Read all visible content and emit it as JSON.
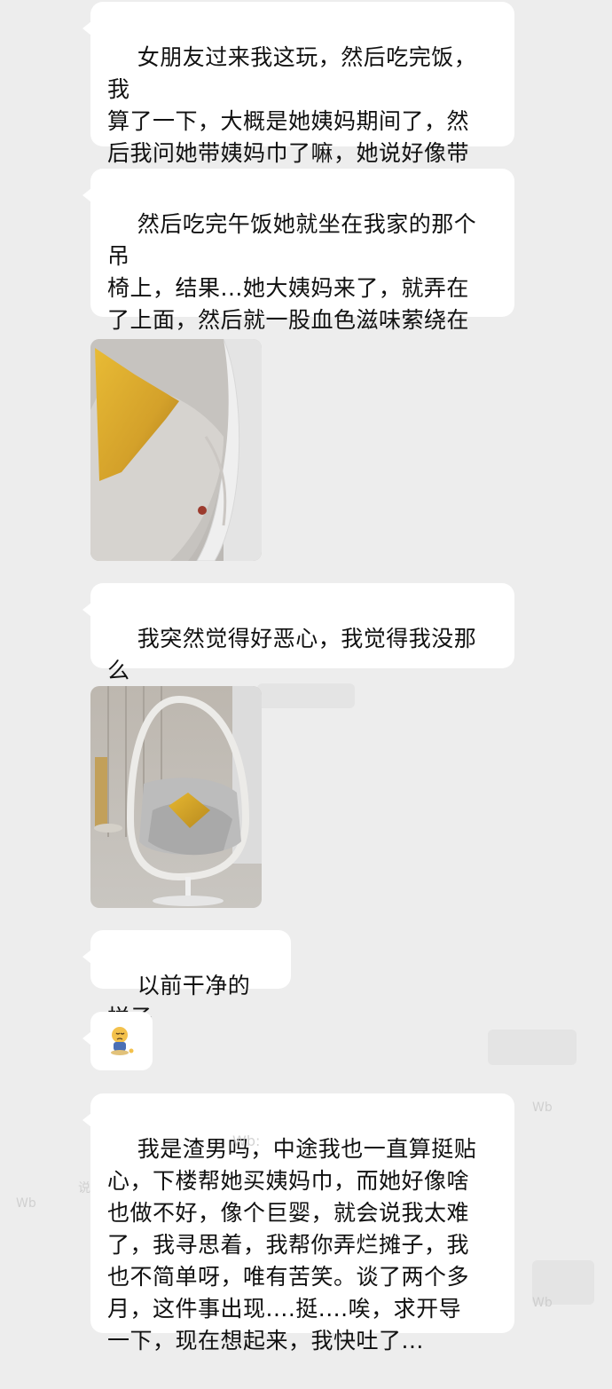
{
  "messages": [
    {
      "type": "text",
      "text": "女朋友过来我这玩，然后吃完饭，我\n算了一下，大概是她姨妈期间了，然\n后我问她带姨妈巾了嘛，她说好像带\n了，这是前提。"
    },
    {
      "type": "text",
      "text": "然后吃完午饭她就坐在我家的那个吊\n椅上，结果...她大姨妈来了，就弄在\n了上面，然后就一股血色滋味萦绕在\n鼻子。。。。"
    },
    {
      "type": "image",
      "icon": "stained-cushion-photo"
    },
    {
      "type": "text",
      "text": "我突然觉得好恶心，我觉得我没那么\n喜欢她了......"
    },
    {
      "type": "image",
      "icon": "hanging-chair-photo"
    },
    {
      "type": "text",
      "text": "以前干净的样子"
    },
    {
      "type": "emoji",
      "icon": "sad-sitting-emoji"
    },
    {
      "type": "text",
      "text": "我是渣男吗，中途我也一直算挺贴\n心，下楼帮她买姨妈巾，而她好像啥\n也做不好，像个巨婴，就会说我太难\n了，我寻思着，我帮你弄烂摊子，我\n也不简单呀，唯有苦笑。谈了两个多\n月，这件事出现....挺....唉，求开导\n一下，现在想起来，我快吐了..."
    }
  ],
  "watermarks": [
    "Wb:",
    "Wb",
    "Wb",
    "Wb",
    "说"
  ],
  "colors": {
    "background": "#ededed",
    "bubble": "#ffffff",
    "text": "#111111",
    "cushion_yellow": "#d9a62a",
    "stain_red": "#9c3b2e"
  }
}
